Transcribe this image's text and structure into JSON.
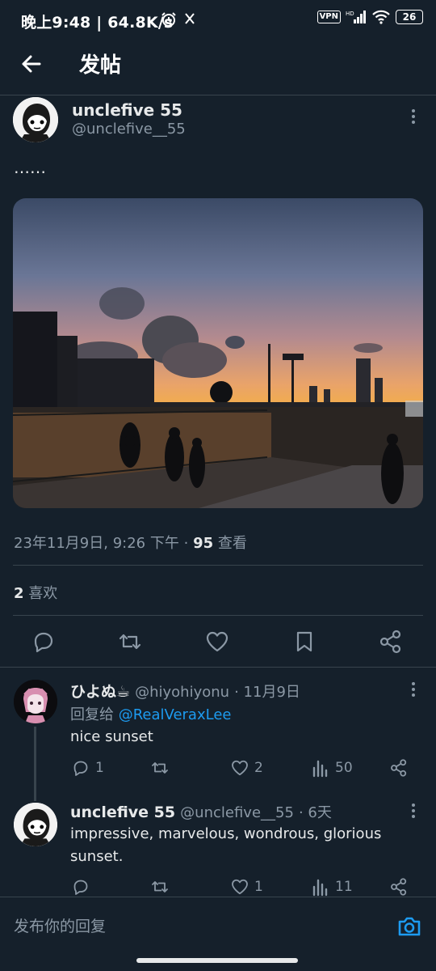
{
  "status_bar": {
    "time": "晚上9:48",
    "speed": "64.8K/s",
    "vpn": "VPN",
    "battery": "26"
  },
  "header": {
    "title": "发帖"
  },
  "tweet": {
    "display_name": "unclefive 55",
    "handle": "@unclefive__55",
    "text": "……",
    "timestamp": "23年11月9日, 9:26 下午",
    "separator": "·",
    "views_count": "95",
    "views_label": "查看",
    "likes_count": "2",
    "likes_label": "喜欢"
  },
  "replies": [
    {
      "display_name": "ひよぬ☕",
      "handle": "@hiyohiyonu",
      "time": "· 11月9日",
      "reply_to_label": "回复给",
      "reply_to_handle": "@RealVeraxLee",
      "text": "nice sunset",
      "comments": "1",
      "retweets": "",
      "likes": "2",
      "views": "50"
    },
    {
      "display_name": "unclefive 55",
      "handle": "@unclefive__55",
      "time": "· 6天",
      "text": "impressive, marvelous, wondrous, glorious sunset.",
      "comments": "",
      "retweets": "",
      "likes": "1",
      "views": "11"
    }
  ],
  "reply_box": {
    "placeholder": "发布你的回复"
  },
  "colors": {
    "background": "#15202b",
    "text": "#e7e9ea",
    "muted": "#8b98a5",
    "accent": "#1d9bf0",
    "divider": "#38444d"
  }
}
